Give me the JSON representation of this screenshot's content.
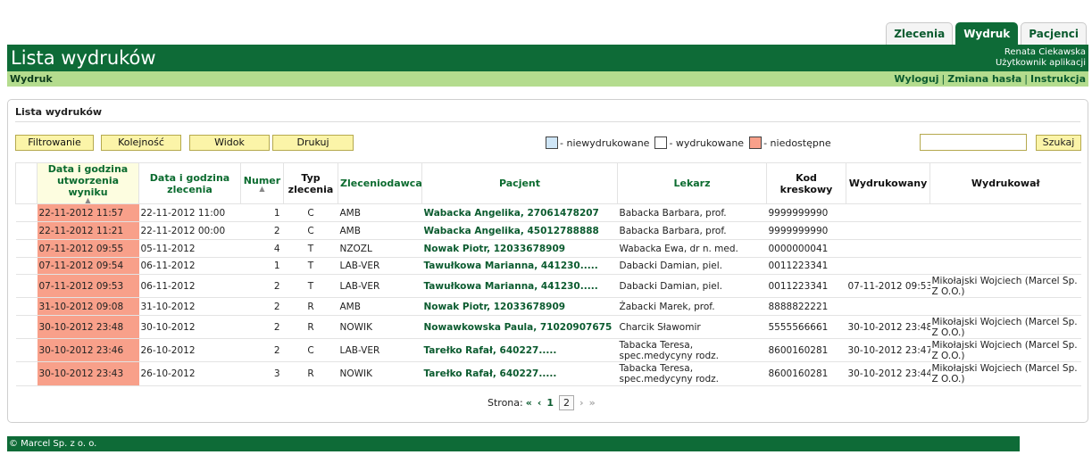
{
  "tabs": [
    "Zlecenia",
    "Wydruk",
    "Pacjenci"
  ],
  "header": {
    "title": "Lista wydruków",
    "user_name": "Renata Ciekawska",
    "user_role": "Użytkownik aplikacji"
  },
  "subbar": {
    "section": "Wydruk",
    "logout": "Wyloguj",
    "change_password": "Zmiana hasła",
    "instructions": "Instrukcja",
    "sep": "|"
  },
  "panel": {
    "title": "Lista wydruków",
    "buttons": {
      "filter": "Filtrowanie",
      "order": "Kolejność",
      "view": "Widok",
      "print": "Drukuj",
      "search": "Szukaj"
    },
    "legend": {
      "not_printed": "- niewydrukowane",
      "printed": "- wydrukowane",
      "unavailable": "- niedostępne",
      "colors": {
        "not_printed": "#cfe6f7",
        "printed": "#ffffff",
        "unavailable": "#f8a08a"
      }
    },
    "search_value": ""
  },
  "table": {
    "headers": {
      "result_date": "Data i godzina utworzenia wyniku",
      "order_date": "Data i godzina zlecenia",
      "number": "Numer",
      "order_type": "Typ zlecenia",
      "orderer": "Zleceniodawca",
      "patient": "Pacjent",
      "doctor": "Lekarz",
      "barcode": "Kod kreskowy",
      "printed": "Wydrukowany",
      "printed_by": "Wydrukował"
    },
    "rows": [
      {
        "result_date": "22-11-2012 11:57",
        "order_date": "22-11-2012 11:00",
        "number": "1",
        "type": "C",
        "orderer": "AMB",
        "patient": "Wabacka Angelika, 27061478207",
        "doctor": "Babacka Barbara, prof.",
        "barcode": "9999999990",
        "printed": "",
        "printed_by": ""
      },
      {
        "result_date": "22-11-2012 11:21",
        "order_date": "22-11-2012 00:00",
        "number": "2",
        "type": "C",
        "orderer": "AMB",
        "patient": "Wabacka Angelika, 45012788888",
        "doctor": "Babacka Barbara, prof.",
        "barcode": "9999999990",
        "printed": "",
        "printed_by": ""
      },
      {
        "result_date": "07-11-2012 09:55",
        "order_date": "05-11-2012",
        "number": "4",
        "type": "T",
        "orderer": "NZOZL",
        "patient": "Nowak Piotr, 12033678909",
        "doctor": "Wabacka Ewa, dr n. med.",
        "barcode": "0000000041",
        "printed": "",
        "printed_by": ""
      },
      {
        "result_date": "07-11-2012 09:54",
        "order_date": "06-11-2012",
        "number": "1",
        "type": "T",
        "orderer": "LAB-VER",
        "patient": "Tawułkowa Marianna, 441230.....",
        "doctor": "Dabacki Damian, piel.",
        "barcode": "0011223341",
        "printed": "",
        "printed_by": ""
      },
      {
        "result_date": "07-11-2012 09:53",
        "order_date": "06-11-2012",
        "number": "2",
        "type": "T",
        "orderer": "LAB-VER",
        "patient": "Tawułkowa Marianna, 441230.....",
        "doctor": "Dabacki Damian, piel.",
        "barcode": "0011223341",
        "printed": "07-11-2012 09:53",
        "printed_by": "Mikołajski Wojciech (Marcel Sp. Z O.O.)"
      },
      {
        "result_date": "31-10-2012 09:08",
        "order_date": "31-10-2012",
        "number": "2",
        "type": "R",
        "orderer": "AMB",
        "patient": "Nowak Piotr, 12033678909",
        "doctor": "Żabacki Marek, prof.",
        "barcode": "8888822221",
        "printed": "",
        "printed_by": ""
      },
      {
        "result_date": "30-10-2012 23:48",
        "order_date": "30-10-2012",
        "number": "2",
        "type": "R",
        "orderer": "NOWIK",
        "patient": "Nowawkowska Paula, 71020907675",
        "doctor": "Charcik Sławomir",
        "barcode": "5555566661",
        "printed": "30-10-2012 23:48",
        "printed_by": "Mikołajski Wojciech (Marcel Sp. Z O.O.)"
      },
      {
        "result_date": "30-10-2012 23:46",
        "order_date": "26-10-2012",
        "number": "2",
        "type": "C",
        "orderer": "LAB-VER",
        "patient": "Tarełko Rafał, 640227.....",
        "doctor": "Tabacka Teresa, spec.medycyny rodz.",
        "barcode": "8600160281",
        "printed": "30-10-2012 23:47",
        "printed_by": "Mikołajski Wojciech (Marcel Sp. Z O.O.)"
      },
      {
        "result_date": "30-10-2012 23:43",
        "order_date": "26-10-2012",
        "number": "3",
        "type": "R",
        "orderer": "NOWIK",
        "patient": "Tarełko Rafał, 640227.....",
        "doctor": "Tabacka Teresa, spec.medycyny rodz.",
        "barcode": "8600160281",
        "printed": "30-10-2012 23:44",
        "printed_by": "Mikołajski Wojciech (Marcel Sp. Z O.O.)"
      }
    ]
  },
  "pager": {
    "label": "Strona:",
    "first": "«",
    "prev": "‹",
    "pages": [
      "1",
      "2"
    ],
    "current": "2",
    "next": "›",
    "last": "»"
  },
  "footer": "© Marcel Sp. z o. o."
}
